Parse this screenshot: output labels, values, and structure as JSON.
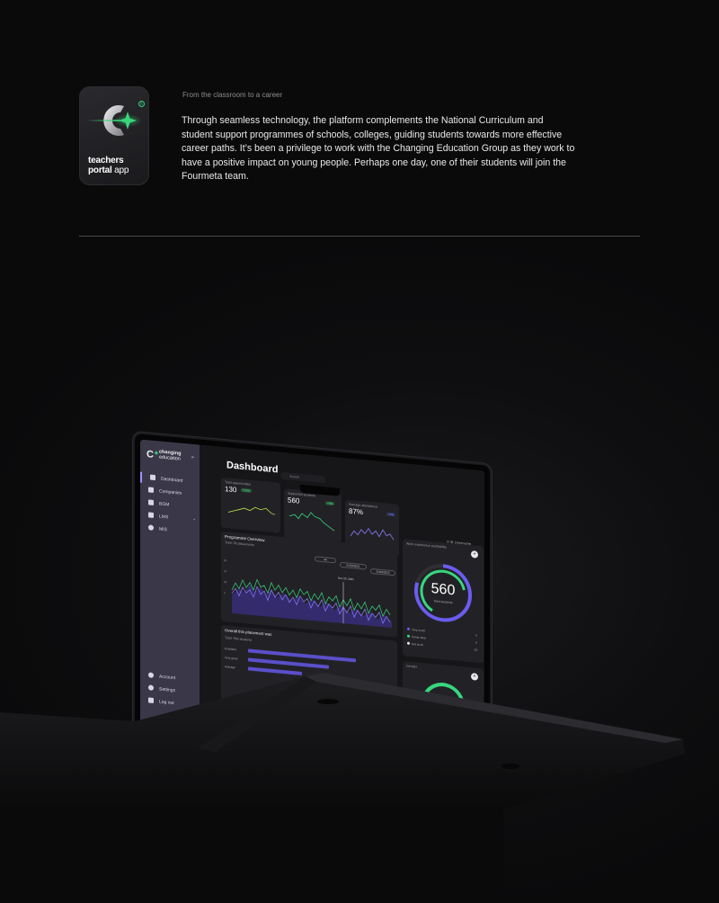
{
  "app_icon": {
    "line1": "teachers",
    "line2_bold": "portal",
    "line2_rest": " app",
    "registered": "R",
    "accent": "#39d37a"
  },
  "header": {
    "kicker": "From the classroom to a career",
    "intro": "Through seamless technology, the platform complements the National Curriculum and student support programmes of schools, colleges, guiding students towards more effective career paths. It’s been a privilege to work with the Changing Education Group as they work to have a positive impact on young people. Perhaps one day, one of their students will join the Fourmeta team."
  },
  "dashboard": {
    "brand_line1": "changing",
    "brand_line2": "education",
    "title": "Dashboard",
    "search_placeholder": "Search",
    "user_name": "Username",
    "nav": [
      {
        "label": "Dashboard",
        "icon": "grid-icon"
      },
      {
        "label": "Companies",
        "icon": "building-icon"
      },
      {
        "label": "BGM",
        "icon": "folder-icon"
      },
      {
        "label": "LMS",
        "icon": "document-icon"
      },
      {
        "label": "MIS",
        "icon": "user-icon"
      }
    ],
    "nav_bottom": [
      {
        "label": "Account",
        "icon": "gear-icon"
      },
      {
        "label": "Settings",
        "icon": "person-icon"
      },
      {
        "label": "Log out",
        "icon": "logout-icon"
      }
    ],
    "kpis": [
      {
        "label": "Total opportunities",
        "value": "130",
        "badge": "+12%"
      },
      {
        "label": "Supported students",
        "value": "560",
        "badge": "+8%"
      },
      {
        "label": "Average attendance",
        "value": "87%",
        "badge": "+2%"
      }
    ],
    "programme": {
      "title": "Programme Overview",
      "subtitle": "Total: 56 placements",
      "filters": [
        "All",
        "01/09/2021",
        "31/08/2022"
      ],
      "tooltip": "Nov 24, 2021",
      "y_ticks": [
        "60",
        "40",
        "20",
        "0"
      ],
      "x_ticks": [
        "Aug",
        "Sep",
        "Oct",
        "Nov",
        "Dec",
        "Jan",
        "Feb",
        "Mar",
        "Apr",
        "May",
        "Jun",
        "Jul",
        "Aug"
      ]
    },
    "experience": {
      "title": "Work experience profitability",
      "value": "560",
      "sub": "Total students",
      "legend": [
        {
          "label": "Very much",
          "value": "0",
          "color": "#6b5cf0"
        },
        {
          "label": "Some what",
          "value": "0",
          "color": "#38d67d"
        },
        {
          "label": "Not at all",
          "value": "33",
          "color": "#e8e8ea"
        }
      ]
    },
    "placement": {
      "title": "Overall this placement was",
      "subtitle": "Total: 560 students",
      "rows": [
        "Excellent",
        "Very good",
        "Average"
      ]
    },
    "gender": {
      "title": "Gender"
    }
  }
}
